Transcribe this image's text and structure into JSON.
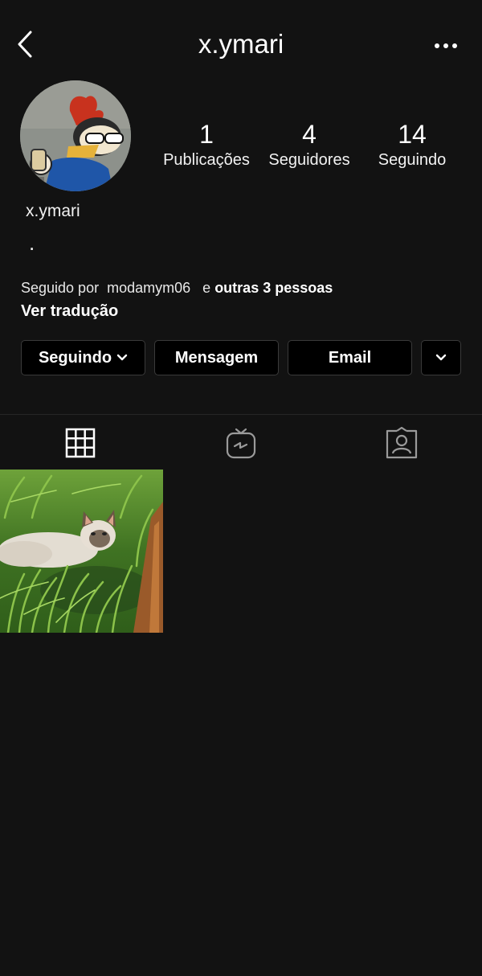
{
  "header": {
    "title": "x.ymari",
    "back_icon": "chevron-left-icon",
    "more_icon": "ellipsis-icon"
  },
  "profile": {
    "name": "x.ymari",
    "bio": "."
  },
  "stats": {
    "posts": {
      "value": "1",
      "label": "Publicações"
    },
    "followers": {
      "value": "4",
      "label": "Seguidores"
    },
    "following": {
      "value": "14",
      "label": "Seguindo"
    }
  },
  "followed_by": {
    "prefix": "Seguido por",
    "user": "modamym06",
    "connector": "e",
    "others": "outras 3 pessoas"
  },
  "translate_label": "Ver tradução",
  "actions": {
    "following_label": "Seguindo",
    "message_label": "Mensagem",
    "email_label": "Email"
  },
  "tabs": [
    {
      "icon": "grid-icon"
    },
    {
      "icon": "igtv-icon"
    },
    {
      "icon": "tagged-person-icon"
    }
  ],
  "colors": {
    "background": "#121212",
    "button_bg": "#000000",
    "button_border": "#3a3a3a",
    "divider": "#262626"
  }
}
